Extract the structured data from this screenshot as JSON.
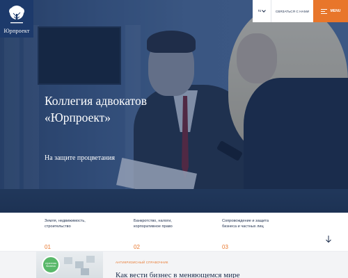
{
  "brand": {
    "name": "Юрпроект"
  },
  "topbar": {
    "language": "ru",
    "contact_label": "СВЯЗАТЬСЯ С НАМИ",
    "menu_label": "MENU"
  },
  "hero": {
    "title_line1": "Коллегия адвокатов",
    "title_line2": "«Юрпроект»",
    "subtitle": "На защите процветания"
  },
  "services": [
    {
      "line1": "Земля, недвижимость,",
      "line2": "строительство",
      "number": "01"
    },
    {
      "line1": "Банкротство, налоги,",
      "line2": "корпоративное право",
      "number": "02"
    },
    {
      "line1": "Сопровождение и защита",
      "line2": "бизнеса и частных лиц",
      "number": "03"
    }
  ],
  "article": {
    "tag": "АНТИКРИЗИСНЫЙ СПРАВОЧНИК",
    "title": "Как вести бизнес в меняющемся мире",
    "badge_text": "стратегия бизнеса"
  },
  "colors": {
    "accent": "#e8762b",
    "navy": "#1d3a6b",
    "text": "#1c2d4c"
  },
  "icons": {
    "logo": "tree-icon",
    "language": "chevron-down-icon",
    "menu": "hamburger-icon",
    "scroll": "arrow-down-icon"
  }
}
